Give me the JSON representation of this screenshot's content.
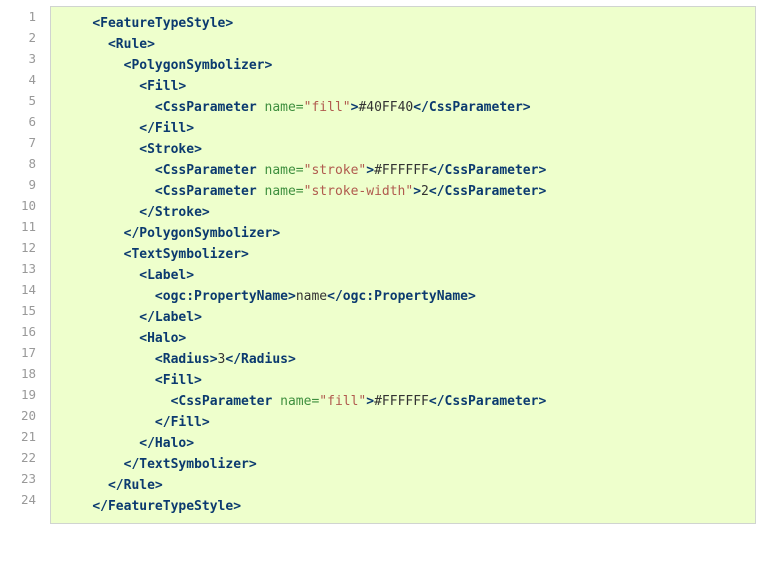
{
  "lines": [
    {
      "indent": 4,
      "type": "open",
      "tag": "FeatureTypeStyle"
    },
    {
      "indent": 6,
      "type": "open",
      "tag": "Rule"
    },
    {
      "indent": 8,
      "type": "open",
      "tag": "PolygonSymbolizer"
    },
    {
      "indent": 10,
      "type": "open",
      "tag": "Fill"
    },
    {
      "indent": 12,
      "type": "leaf",
      "tag": "CssParameter",
      "attrName": "name",
      "attrValue": "fill",
      "text": "#40FF40"
    },
    {
      "indent": 10,
      "type": "close",
      "tag": "Fill"
    },
    {
      "indent": 10,
      "type": "open",
      "tag": "Stroke"
    },
    {
      "indent": 12,
      "type": "leaf",
      "tag": "CssParameter",
      "attrName": "name",
      "attrValue": "stroke",
      "text": "#FFFFFF"
    },
    {
      "indent": 12,
      "type": "leaf",
      "tag": "CssParameter",
      "attrName": "name",
      "attrValue": "stroke-width",
      "text": "2"
    },
    {
      "indent": 10,
      "type": "close",
      "tag": "Stroke"
    },
    {
      "indent": 8,
      "type": "close",
      "tag": "PolygonSymbolizer"
    },
    {
      "indent": 8,
      "type": "open",
      "tag": "TextSymbolizer"
    },
    {
      "indent": 10,
      "type": "open",
      "tag": "Label"
    },
    {
      "indent": 12,
      "type": "leaf",
      "tag": "ogc:PropertyName",
      "text": "name"
    },
    {
      "indent": 10,
      "type": "close",
      "tag": "Label"
    },
    {
      "indent": 10,
      "type": "open",
      "tag": "Halo"
    },
    {
      "indent": 12,
      "type": "leaf",
      "tag": "Radius",
      "text": "3"
    },
    {
      "indent": 12,
      "type": "open",
      "tag": "Fill"
    },
    {
      "indent": 14,
      "type": "leaf",
      "tag": "CssParameter",
      "attrName": "name",
      "attrValue": "fill",
      "text": "#FFFFFF"
    },
    {
      "indent": 12,
      "type": "close",
      "tag": "Fill"
    },
    {
      "indent": 10,
      "type": "close",
      "tag": "Halo"
    },
    {
      "indent": 8,
      "type": "close",
      "tag": "TextSymbolizer"
    },
    {
      "indent": 6,
      "type": "close",
      "tag": "Rule"
    },
    {
      "indent": 4,
      "type": "close",
      "tag": "FeatureTypeStyle"
    }
  ]
}
